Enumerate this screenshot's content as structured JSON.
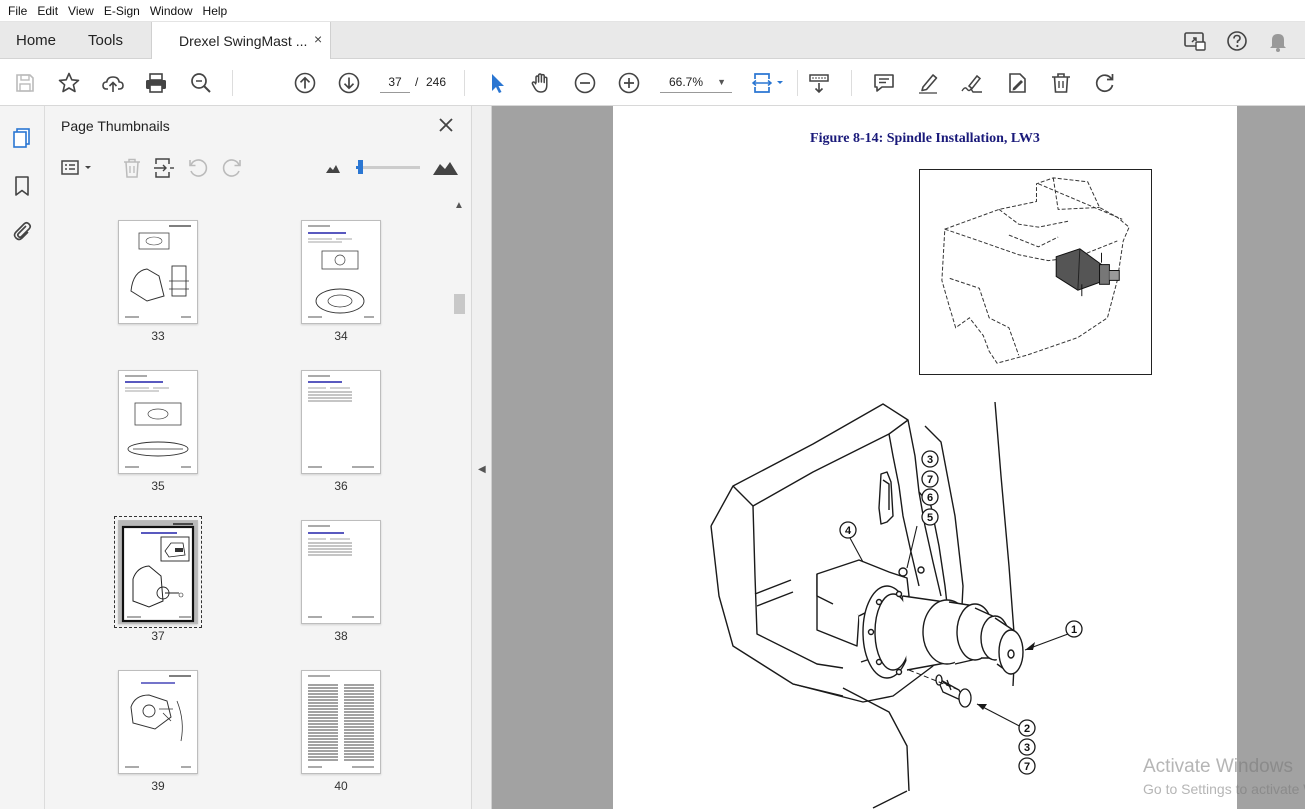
{
  "menu": [
    "File",
    "Edit",
    "View",
    "E-Sign",
    "Window",
    "Help"
  ],
  "tabs": {
    "home": "Home",
    "tools": "Tools",
    "document": "Drexel  SwingMast ...",
    "close": "×"
  },
  "toolbar": {
    "current_page": "37",
    "page_separator": "/",
    "total_pages": "246",
    "zoom": "66.7%",
    "zoom_caret": "▼"
  },
  "thumbnail_panel": {
    "title": "Page Thumbnails",
    "close": "✕",
    "pages": [
      "33",
      "34",
      "35",
      "36",
      "37",
      "38",
      "39",
      "40"
    ],
    "selected_page": "37",
    "thumbnail_size_level": 0.05
  },
  "document": {
    "figure_title": "Figure 8-14:  Spindle Installation, LW3",
    "callouts": [
      "3",
      "7",
      "6",
      "5",
      "4",
      "1",
      "2",
      "3",
      "7"
    ]
  },
  "watermark": {
    "line1": "Activate Windows",
    "line2": "Go to Settings to activate Windows."
  },
  "colors": {
    "accent": "#2a76d2",
    "figure_title": "#1a1a7a",
    "doc_background": "#a2a2a2"
  }
}
